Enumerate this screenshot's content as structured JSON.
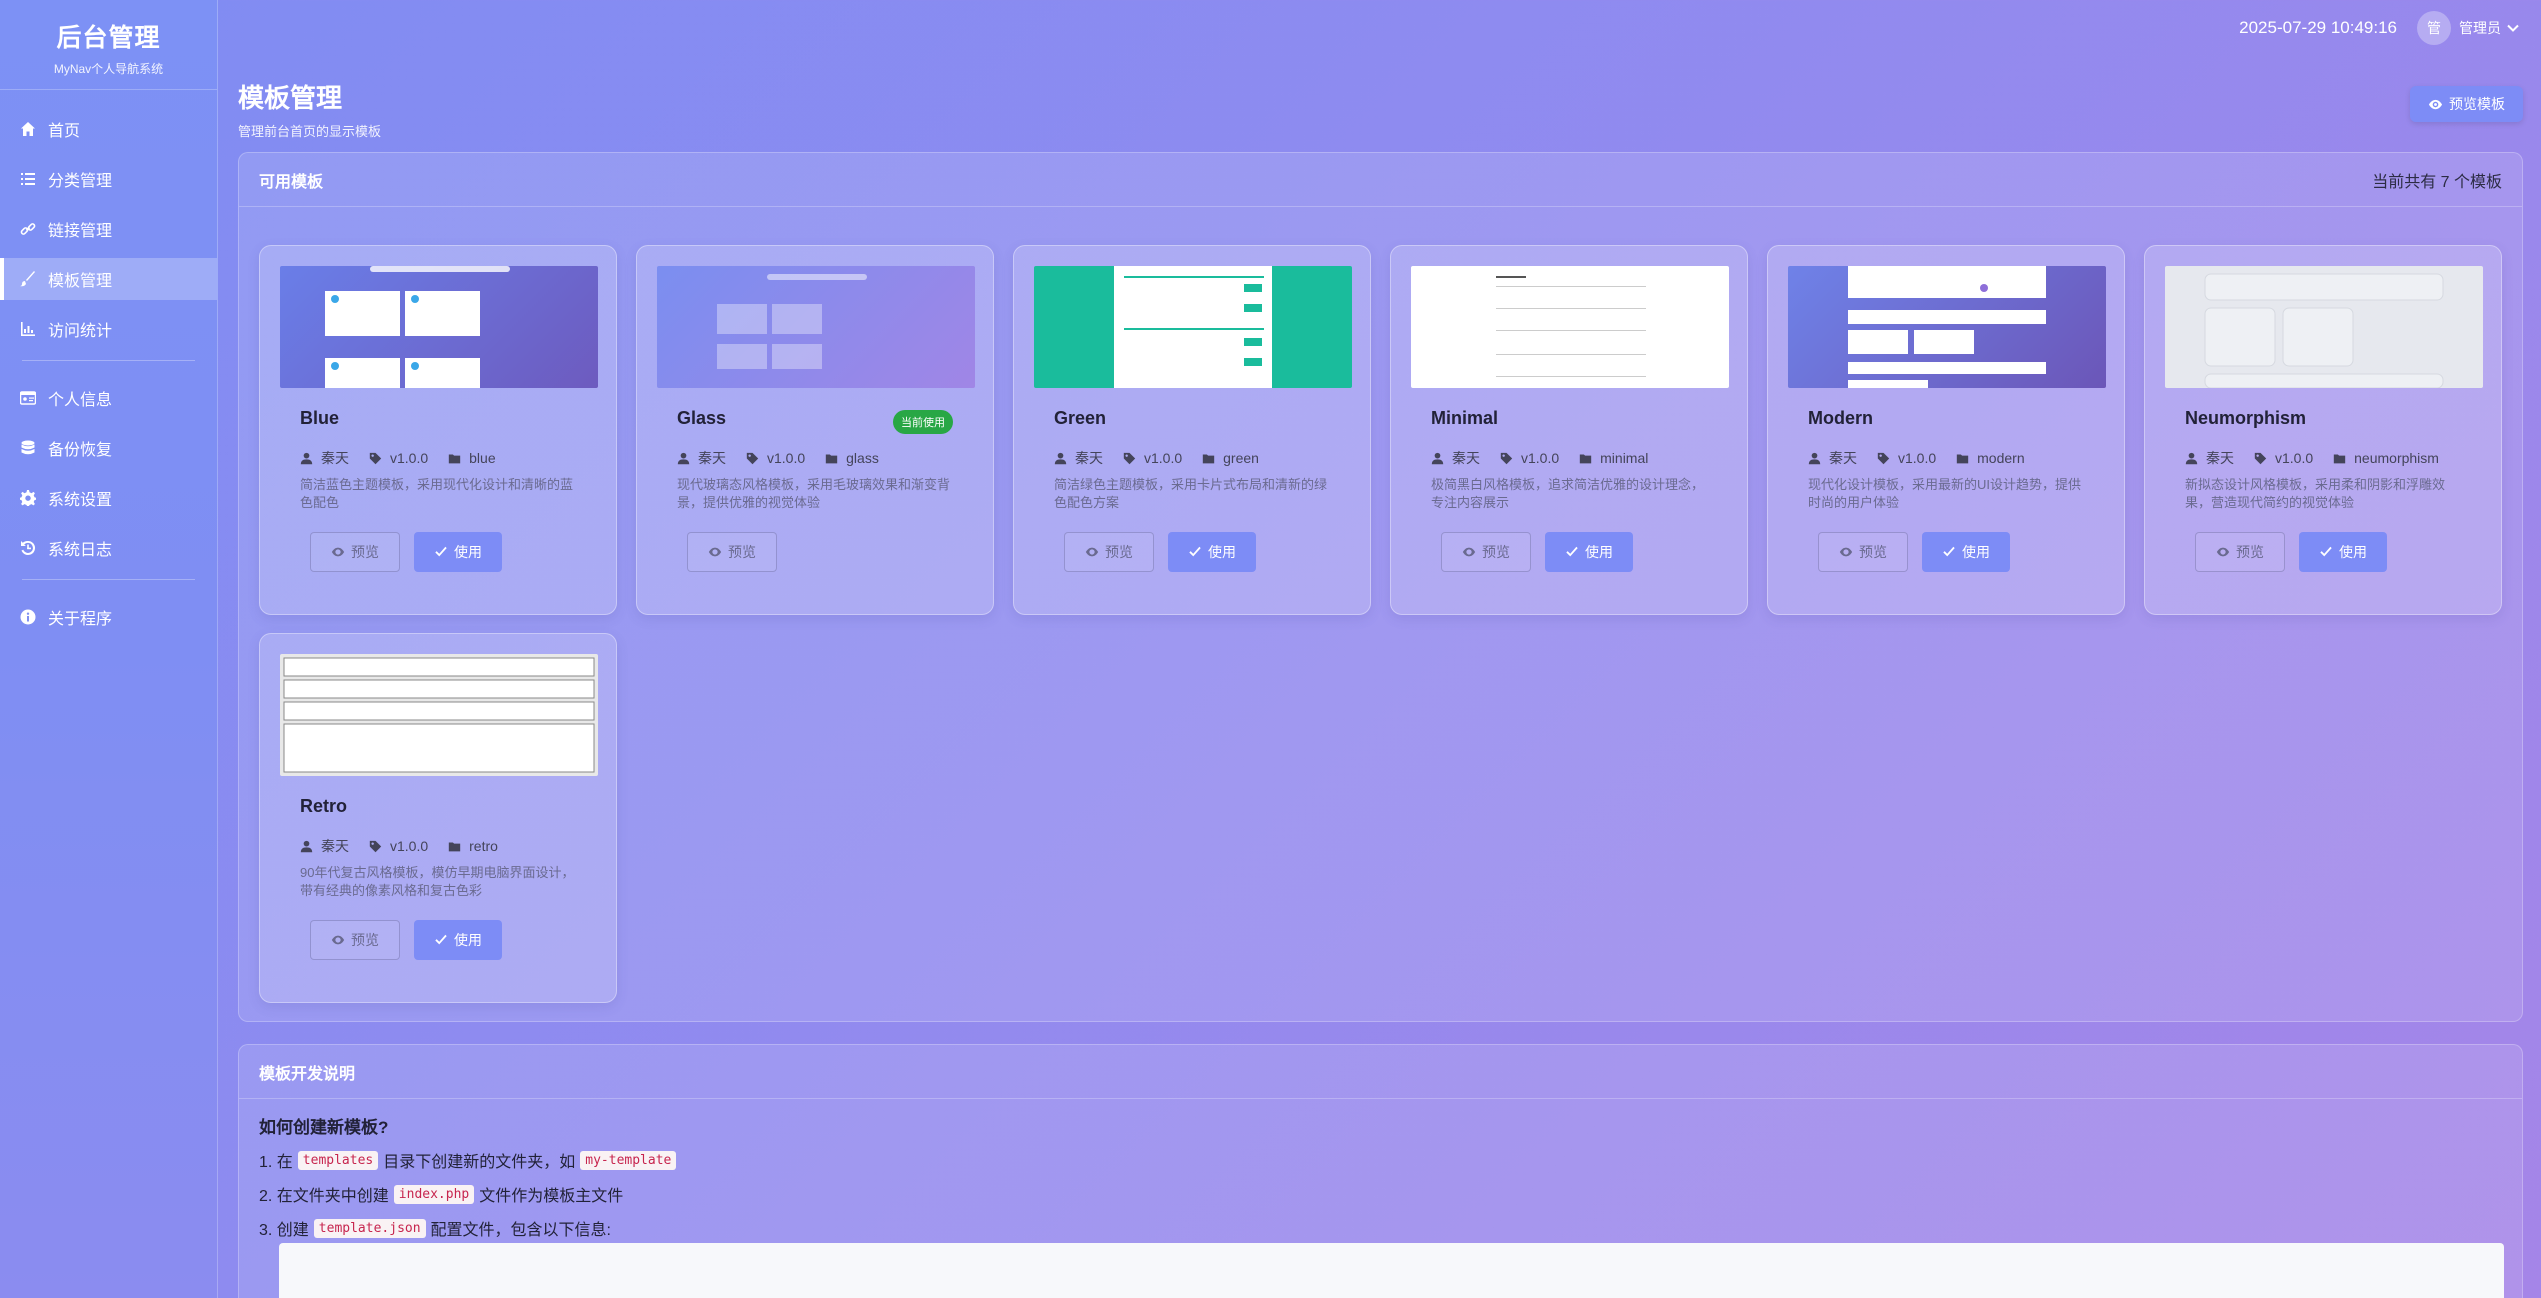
{
  "sidebar": {
    "title": "后台管理",
    "subtitle": "MyNav个人导航系统",
    "items": [
      {
        "label": "首页",
        "icon": "home-icon"
      },
      {
        "label": "分类管理",
        "icon": "list-icon"
      },
      {
        "label": "链接管理",
        "icon": "link-icon"
      },
      {
        "label": "模板管理",
        "icon": "brush-icon"
      },
      {
        "label": "访问统计",
        "icon": "chart-icon"
      },
      {
        "label": "个人信息",
        "icon": "id-card-icon"
      },
      {
        "label": "备份恢复",
        "icon": "database-icon"
      },
      {
        "label": "系统设置",
        "icon": "gear-icon"
      },
      {
        "label": "系统日志",
        "icon": "history-icon"
      },
      {
        "label": "关于程序",
        "icon": "info-icon"
      }
    ]
  },
  "topbar": {
    "datetime": "2025-07-29 10:49:16",
    "avatar_text": "管",
    "username": "管理员"
  },
  "page": {
    "title": "模板管理",
    "subtitle": "管理前台首页的显示模板",
    "preview_button": "预览模板"
  },
  "templates_panel": {
    "title": "可用模板",
    "count_text": "当前共有 7 个模板"
  },
  "templates": [
    {
      "name": "Blue",
      "author": "秦天",
      "version": "v1.0.0",
      "dir": "blue",
      "desc": "简洁蓝色主题模板，采用现代化设计和清晰的蓝色配色",
      "preview": "预览",
      "use": "使用"
    },
    {
      "name": "Glass",
      "author": "秦天",
      "version": "v1.0.0",
      "dir": "glass",
      "desc": "现代玻璃态风格模板，采用毛玻璃效果和渐变背景，提供优雅的视觉体验",
      "preview": "预览",
      "badge": "当前使用"
    },
    {
      "name": "Green",
      "author": "秦天",
      "version": "v1.0.0",
      "dir": "green",
      "desc": "简洁绿色主题模板，采用卡片式布局和清新的绿色配色方案",
      "preview": "预览",
      "use": "使用"
    },
    {
      "name": "Minimal",
      "author": "秦天",
      "version": "v1.0.0",
      "dir": "minimal",
      "desc": "极简黑白风格模板，追求简洁优雅的设计理念，专注内容展示",
      "preview": "预览",
      "use": "使用"
    },
    {
      "name": "Modern",
      "author": "秦天",
      "version": "v1.0.0",
      "dir": "modern",
      "desc": "现代化设计模板，采用最新的UI设计趋势，提供时尚的用户体验",
      "preview": "预览",
      "use": "使用"
    },
    {
      "name": "Neumorphism",
      "author": "秦天",
      "version": "v1.0.0",
      "dir": "neumorphism",
      "desc": "新拟态设计风格模板，采用柔和阴影和浮雕效果，营造现代简约的视觉体验",
      "preview": "预览",
      "use": "使用"
    },
    {
      "name": "Retro",
      "author": "秦天",
      "version": "v1.0.0",
      "dir": "retro",
      "desc": "90年代复古风格模板，模仿早期电脑界面设计，带有经典的像素风格和复古色彩",
      "preview": "预览",
      "use": "使用"
    }
  ],
  "dev_panel": {
    "title": "模板开发说明",
    "question": "如何创建新模板?",
    "step1_a": "1. 在",
    "step1_code1": "templates",
    "step1_b": "目录下创建新的文件夹，如",
    "step1_code2": "my-template",
    "step2_a": "2. 在文件夹中创建",
    "step2_code": "index.php",
    "step2_b": "文件作为模板主文件",
    "step3_a": "3. 创建",
    "step3_code": "template.json",
    "step3_b": "配置文件，包含以下信息:"
  },
  "colors": {
    "accent": "#7d8cf6",
    "badge_green": "#28a745"
  }
}
